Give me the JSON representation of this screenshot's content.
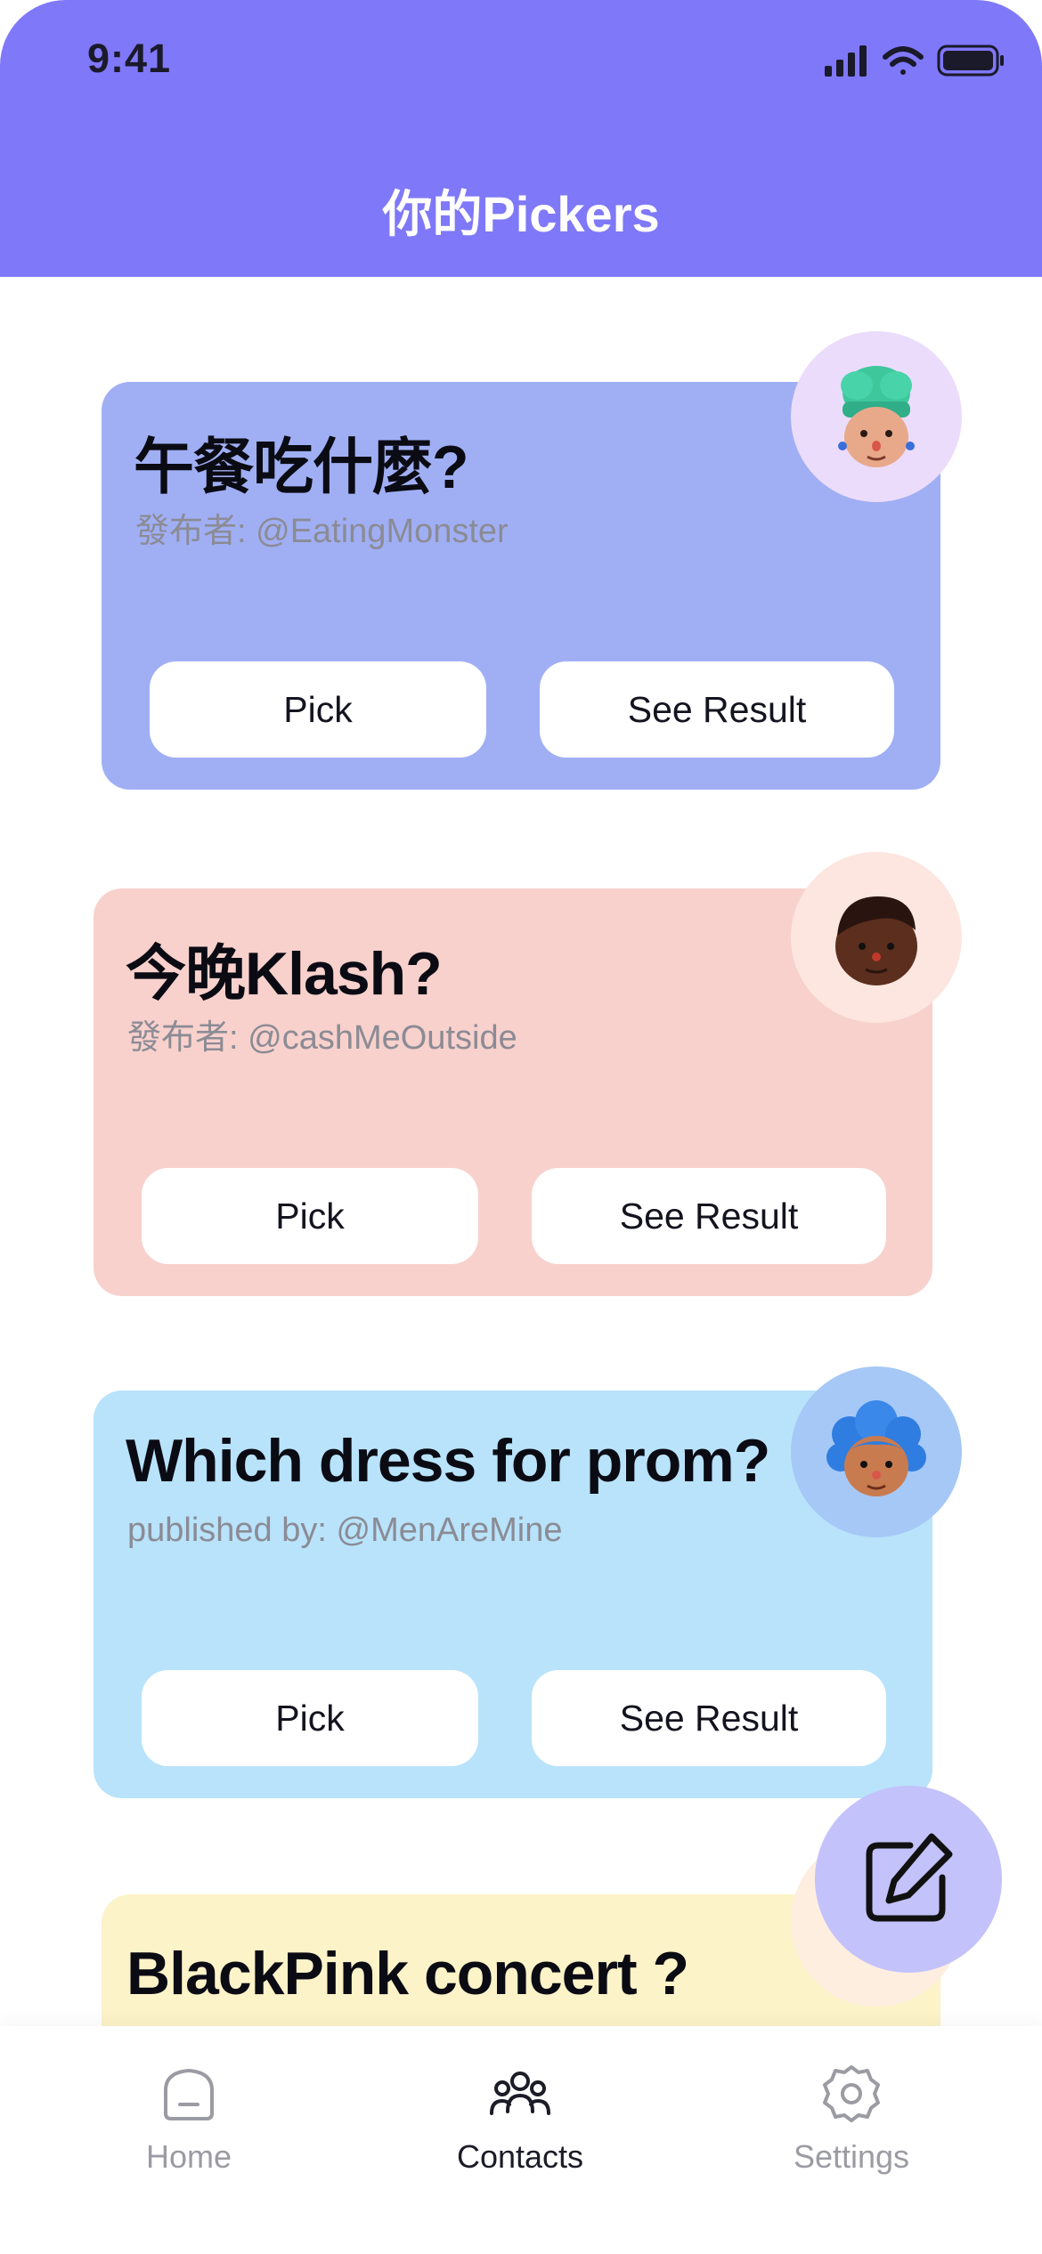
{
  "status_bar": {
    "time": "9:41"
  },
  "header": {
    "title": "你的Pickers"
  },
  "cards": [
    {
      "title": "午餐吃什麼?",
      "publisher": "發布者: @EatingMonster",
      "pick_label": "Pick",
      "result_label": "See Result",
      "bg_color": "#a0aff4",
      "avatar": "chef-avatar-icon"
    },
    {
      "title": "今晚Klash?",
      "publisher": "發布者: @cashMeOutside",
      "pick_label": "Pick",
      "result_label": "See Result",
      "bg_color": "#f8d1cc",
      "avatar": "man-avatar-icon"
    },
    {
      "title": "Which dress for prom?",
      "publisher": "published by: @MenAreMine",
      "pick_label": "Pick",
      "result_label": "See Result",
      "bg_color": "#b8e3fb",
      "avatar": "curly-hair-avatar-icon"
    },
    {
      "title": "BlackPink concert ?",
      "bg_color": "#fcf3c8"
    }
  ],
  "fab": {
    "icon": "edit-icon"
  },
  "tabbar": {
    "items": [
      {
        "label": "Home",
        "icon": "home-icon",
        "active": false
      },
      {
        "label": "Contacts",
        "icon": "contacts-icon",
        "active": true
      },
      {
        "label": "Settings",
        "icon": "settings-icon",
        "active": false
      }
    ]
  },
  "colors": {
    "header": "#7f78f8",
    "fab": "#c3c2fb",
    "tab_active": "#1c1c28",
    "tab_inactive": "#9b9ba3"
  }
}
